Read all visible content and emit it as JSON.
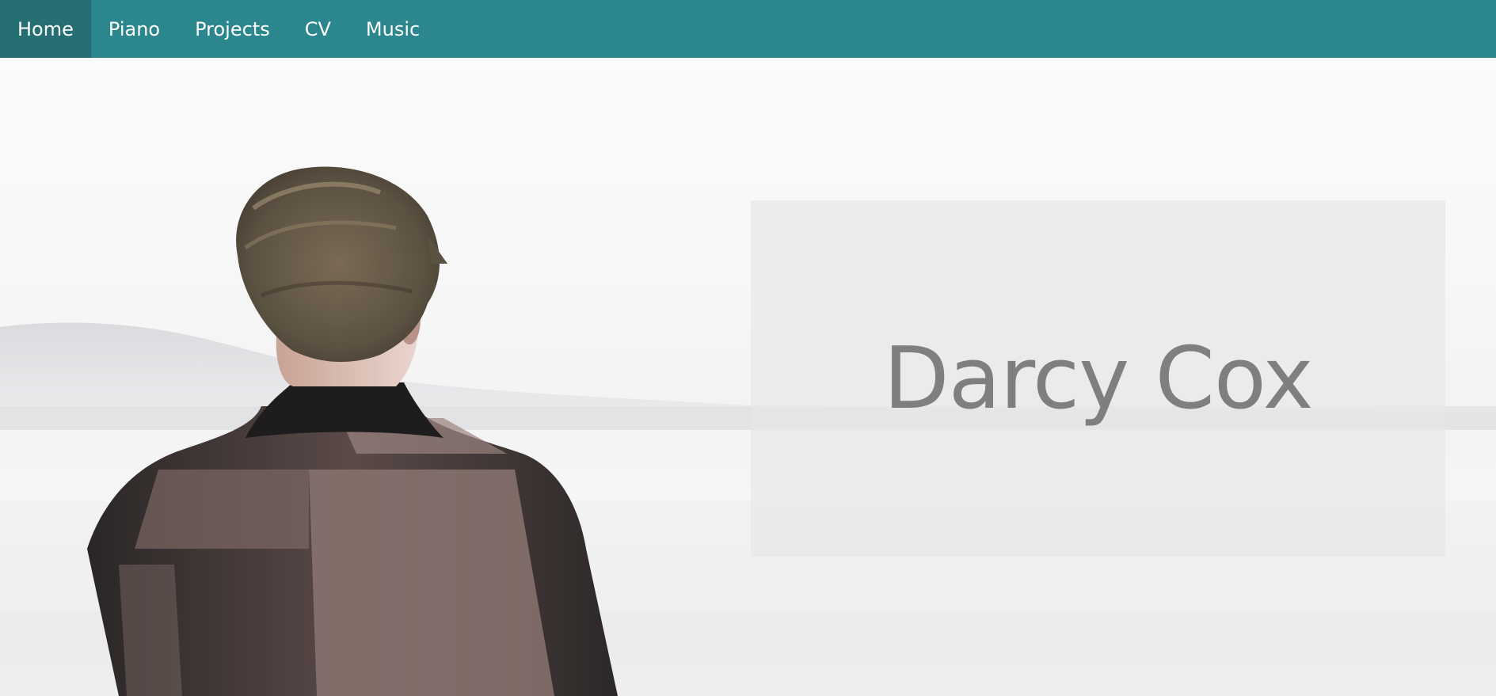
{
  "nav": {
    "items": [
      {
        "label": "Home",
        "active": true
      },
      {
        "label": "Piano",
        "active": false
      },
      {
        "label": "Projects",
        "active": false
      },
      {
        "label": "CV",
        "active": false
      },
      {
        "label": "Music",
        "active": false
      }
    ]
  },
  "hero": {
    "name": "Darcy Cox",
    "image": "person-looking-at-lake-photo"
  },
  "colors": {
    "navbar": "#2c868d",
    "navbar_active": "#256f74",
    "nav_text": "#ffffff",
    "title_text": "#7f7f7f",
    "panel_bg": "#e8e8e8"
  }
}
